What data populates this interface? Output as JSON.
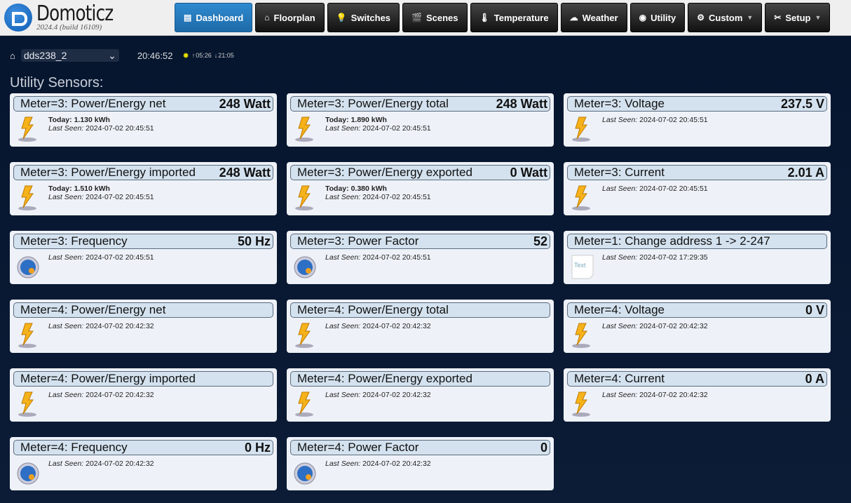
{
  "app": {
    "name": "Domoticz",
    "version": "2024.4 (build 16109)"
  },
  "nav": [
    {
      "label": "Dashboard",
      "icon": "dashboard-icon",
      "active": true
    },
    {
      "label": "Floorplan",
      "icon": "floorplan-icon"
    },
    {
      "label": "Switches",
      "icon": "bulb-icon"
    },
    {
      "label": "Scenes",
      "icon": "clapperboard-icon"
    },
    {
      "label": "Temperature",
      "icon": "thermometer-icon"
    },
    {
      "label": "Weather",
      "icon": "cloud-icon"
    },
    {
      "label": "Utility",
      "icon": "utility-icon"
    },
    {
      "label": "Custom",
      "icon": "gear-icon",
      "dropdown": true
    },
    {
      "label": "Setup",
      "icon": "tools-icon",
      "dropdown": true
    }
  ],
  "subbar": {
    "room": "dds238_2",
    "time": "20:46:52",
    "sunrise": "05:26",
    "sunset": "21:05"
  },
  "section_title": "Utility Sensors:",
  "labels": {
    "today": "Today:",
    "last_seen": "Last Seen:"
  },
  "devices": [
    {
      "name": "Meter=3: Power/Energy net",
      "value": "248 Watt",
      "today": "1.130 kWh",
      "last_seen": "2024-07-02 20:45:51",
      "icon": "lightning-icon"
    },
    {
      "name": "Meter=3: Power/Energy total",
      "value": "248 Watt",
      "today": "1.890 kWh",
      "last_seen": "2024-07-02 20:45:51",
      "icon": "lightning-icon"
    },
    {
      "name": "Meter=3: Voltage",
      "value": "237.5 V",
      "last_seen": "2024-07-02 20:45:51",
      "icon": "lightning-icon"
    },
    {
      "name": "Meter=3: Power/Energy imported",
      "value": "248 Watt",
      "today": "1.510 kWh",
      "last_seen": "2024-07-02 20:45:51",
      "icon": "lightning-icon"
    },
    {
      "name": "Meter=3: Power/Energy exported",
      "value": "0 Watt",
      "today": "0.380 kWh",
      "last_seen": "2024-07-02 20:45:51",
      "icon": "lightning-icon"
    },
    {
      "name": "Meter=3: Current",
      "value": "2.01 A",
      "last_seen": "2024-07-02 20:45:51",
      "icon": "lightning-icon"
    },
    {
      "name": "Meter=3: Frequency",
      "value": "50 Hz",
      "last_seen": "2024-07-02 20:45:51",
      "icon": "globe-icon"
    },
    {
      "name": "Meter=3: Power Factor",
      "value": "52",
      "last_seen": "2024-07-02 20:45:51",
      "icon": "globe-icon"
    },
    {
      "name": "Meter=1: Change address 1 -> 2-247",
      "value": "",
      "last_seen": "2024-07-02 17:29:35",
      "icon": "text-icon",
      "icon_text": "Text"
    },
    {
      "name": "Meter=4: Power/Energy net",
      "value": "",
      "last_seen": "2024-07-02 20:42:32",
      "icon": "lightning-icon"
    },
    {
      "name": "Meter=4: Power/Energy total",
      "value": "",
      "last_seen": "2024-07-02 20:42:32",
      "icon": "lightning-icon"
    },
    {
      "name": "Meter=4: Voltage",
      "value": "0 V",
      "last_seen": "2024-07-02 20:42:32",
      "icon": "lightning-icon"
    },
    {
      "name": "Meter=4: Power/Energy imported",
      "value": "",
      "last_seen": "2024-07-02 20:42:32",
      "icon": "lightning-icon"
    },
    {
      "name": "Meter=4: Power/Energy exported",
      "value": "",
      "last_seen": "2024-07-02 20:42:32",
      "icon": "lightning-icon"
    },
    {
      "name": "Meter=4: Current",
      "value": "0 A",
      "last_seen": "2024-07-02 20:42:32",
      "icon": "lightning-icon"
    },
    {
      "name": "Meter=4: Frequency",
      "value": "0 Hz",
      "last_seen": "2024-07-02 20:42:32",
      "icon": "globe-icon"
    },
    {
      "name": "Meter=4: Power Factor",
      "value": "0",
      "last_seen": "2024-07-02 20:42:32",
      "icon": "globe-icon"
    }
  ]
}
